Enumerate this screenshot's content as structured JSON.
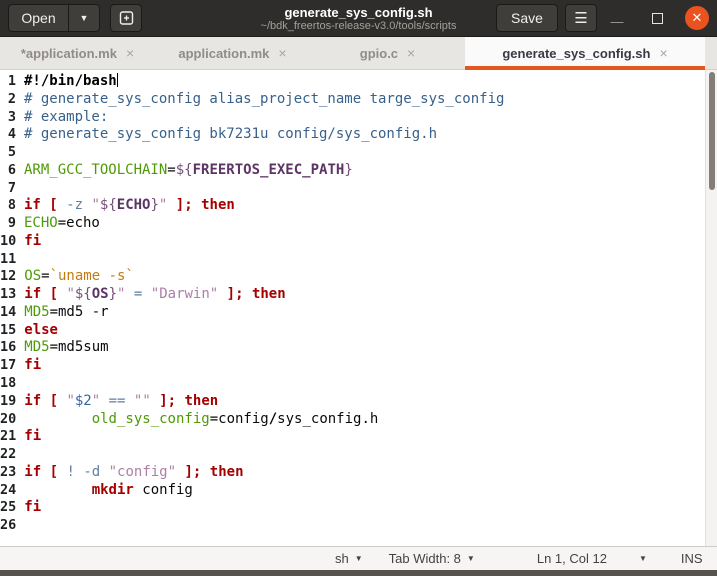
{
  "window": {
    "open_label": "Open",
    "save_label": "Save",
    "title": "generate_sys_config.sh",
    "subtitle": "~/bdk_freertos-release-v3.0/tools/scripts",
    "close_glyph": "✕",
    "hamburger_glyph": "☰",
    "accent_color": "#e4581f",
    "headerbar_color": "#2f2d2b"
  },
  "tabs": [
    {
      "label": "*application.mk",
      "active": false
    },
    {
      "label": "application.mk",
      "active": false
    },
    {
      "label": "gpio.c",
      "active": false
    },
    {
      "label": "generate_sys_config.sh",
      "active": true
    }
  ],
  "statusbar": {
    "language": "sh",
    "tab_width": "Tab Width: 8",
    "position": "Ln 1, Col 12",
    "mode": "INS"
  },
  "syntax_colors": {
    "keyword": "#a40000",
    "variable_assign": "#4e9a06",
    "string": "#ad7fa8",
    "variable_expansion": "#5c3566",
    "comment": "#38618c",
    "positional_param": "#3465a4",
    "operator": "#5f7ea3",
    "backtick_command": "#c17d11"
  },
  "code": {
    "lines": [
      {
        "n": "1",
        "cursor_after": true,
        "tokens": [
          {
            "t": "#!/bin/bash",
            "c": "shebang"
          }
        ]
      },
      {
        "n": "2",
        "tokens": [
          {
            "t": "# generate_sys_config alias_project_name targe_sys_config",
            "c": "comment"
          }
        ]
      },
      {
        "n": "3",
        "tokens": [
          {
            "t": "# example:",
            "c": "comment"
          }
        ]
      },
      {
        "n": "4",
        "tokens": [
          {
            "t": "# generate_sys_config bk7231u config/sys_config.h",
            "c": "comment"
          }
        ]
      },
      {
        "n": "5",
        "tokens": []
      },
      {
        "n": "6",
        "tokens": [
          {
            "t": "ARM_GCC_TOOLCHAIN",
            "c": "var"
          },
          {
            "t": "=",
            "c": "plain"
          },
          {
            "t": "${",
            "c": "vx"
          },
          {
            "t": "FREERTOS_EXEC_PATH",
            "c": "vn"
          },
          {
            "t": "}",
            "c": "vx"
          }
        ]
      },
      {
        "n": "7",
        "tokens": []
      },
      {
        "n": "8",
        "tokens": [
          {
            "t": "if",
            "c": "kw"
          },
          {
            "t": " ",
            "c": "plain"
          },
          {
            "t": "[",
            "c": "kw"
          },
          {
            "t": " ",
            "c": "plain"
          },
          {
            "t": "-z",
            "c": "op"
          },
          {
            "t": " ",
            "c": "plain"
          },
          {
            "t": "\"",
            "c": "str"
          },
          {
            "t": "${",
            "c": "vx"
          },
          {
            "t": "ECHO",
            "c": "vn"
          },
          {
            "t": "}",
            "c": "vx"
          },
          {
            "t": "\"",
            "c": "str"
          },
          {
            "t": " ",
            "c": "plain"
          },
          {
            "t": "];",
            "c": "kw"
          },
          {
            "t": " ",
            "c": "plain"
          },
          {
            "t": "then",
            "c": "kw"
          }
        ]
      },
      {
        "n": "9",
        "tokens": [
          {
            "t": "ECHO",
            "c": "var"
          },
          {
            "t": "=echo",
            "c": "plain"
          }
        ]
      },
      {
        "n": "10",
        "tokens": [
          {
            "t": "fi",
            "c": "kw"
          }
        ]
      },
      {
        "n": "11",
        "tokens": []
      },
      {
        "n": "12",
        "tokens": [
          {
            "t": "OS",
            "c": "var"
          },
          {
            "t": "=",
            "c": "plain"
          },
          {
            "t": "`uname -s`",
            "c": "bt"
          }
        ]
      },
      {
        "n": "13",
        "tokens": [
          {
            "t": "if",
            "c": "kw"
          },
          {
            "t": " ",
            "c": "plain"
          },
          {
            "t": "[",
            "c": "kw"
          },
          {
            "t": " ",
            "c": "plain"
          },
          {
            "t": "\"",
            "c": "str"
          },
          {
            "t": "${",
            "c": "vx"
          },
          {
            "t": "OS",
            "c": "vn"
          },
          {
            "t": "}",
            "c": "vx"
          },
          {
            "t": "\"",
            "c": "str"
          },
          {
            "t": " ",
            "c": "plain"
          },
          {
            "t": "=",
            "c": "op"
          },
          {
            "t": " ",
            "c": "plain"
          },
          {
            "t": "\"Darwin\"",
            "c": "str"
          },
          {
            "t": " ",
            "c": "plain"
          },
          {
            "t": "];",
            "c": "kw"
          },
          {
            "t": " ",
            "c": "plain"
          },
          {
            "t": "then",
            "c": "kw"
          }
        ]
      },
      {
        "n": "14",
        "tokens": [
          {
            "t": "MD5",
            "c": "var"
          },
          {
            "t": "=md5 -r",
            "c": "plain"
          }
        ]
      },
      {
        "n": "15",
        "tokens": [
          {
            "t": "else",
            "c": "kw"
          }
        ]
      },
      {
        "n": "16",
        "tokens": [
          {
            "t": "MD5",
            "c": "var"
          },
          {
            "t": "=md5sum",
            "c": "plain"
          }
        ]
      },
      {
        "n": "17",
        "tokens": [
          {
            "t": "fi",
            "c": "kw"
          }
        ]
      },
      {
        "n": "18",
        "tokens": []
      },
      {
        "n": "19",
        "tokens": [
          {
            "t": "if",
            "c": "kw"
          },
          {
            "t": " ",
            "c": "plain"
          },
          {
            "t": "[",
            "c": "kw"
          },
          {
            "t": " ",
            "c": "plain"
          },
          {
            "t": "\"",
            "c": "str"
          },
          {
            "t": "$2",
            "c": "blue"
          },
          {
            "t": "\"",
            "c": "str"
          },
          {
            "t": " ",
            "c": "plain"
          },
          {
            "t": "==",
            "c": "op"
          },
          {
            "t": " ",
            "c": "plain"
          },
          {
            "t": "\"\"",
            "c": "str"
          },
          {
            "t": " ",
            "c": "plain"
          },
          {
            "t": "];",
            "c": "kw"
          },
          {
            "t": " ",
            "c": "plain"
          },
          {
            "t": "then",
            "c": "kw"
          }
        ]
      },
      {
        "n": "20",
        "tokens": [
          {
            "t": "\t",
            "c": "plain"
          },
          {
            "t": "old_sys_config",
            "c": "var"
          },
          {
            "t": "=config",
            "c": "plain"
          },
          {
            "t": "/",
            "c": "boldplain"
          },
          {
            "t": "sys_config.h",
            "c": "plain"
          }
        ]
      },
      {
        "n": "21",
        "tokens": [
          {
            "t": "fi",
            "c": "kw"
          }
        ]
      },
      {
        "n": "22",
        "tokens": []
      },
      {
        "n": "23",
        "tokens": [
          {
            "t": "if",
            "c": "kw"
          },
          {
            "t": " ",
            "c": "plain"
          },
          {
            "t": "[",
            "c": "kw"
          },
          {
            "t": " ",
            "c": "plain"
          },
          {
            "t": "!",
            "c": "op"
          },
          {
            "t": " ",
            "c": "plain"
          },
          {
            "t": "-d",
            "c": "op"
          },
          {
            "t": " ",
            "c": "plain"
          },
          {
            "t": "\"config\"",
            "c": "str"
          },
          {
            "t": " ",
            "c": "plain"
          },
          {
            "t": "];",
            "c": "kw"
          },
          {
            "t": " ",
            "c": "plain"
          },
          {
            "t": "then",
            "c": "kw"
          }
        ]
      },
      {
        "n": "24",
        "tokens": [
          {
            "t": "\t",
            "c": "plain"
          },
          {
            "t": "mkdir",
            "c": "kw"
          },
          {
            "t": " config",
            "c": "plain"
          }
        ]
      },
      {
        "n": "25",
        "tokens": [
          {
            "t": "fi",
            "c": "kw"
          }
        ]
      },
      {
        "n": "26",
        "tokens": []
      }
    ]
  }
}
